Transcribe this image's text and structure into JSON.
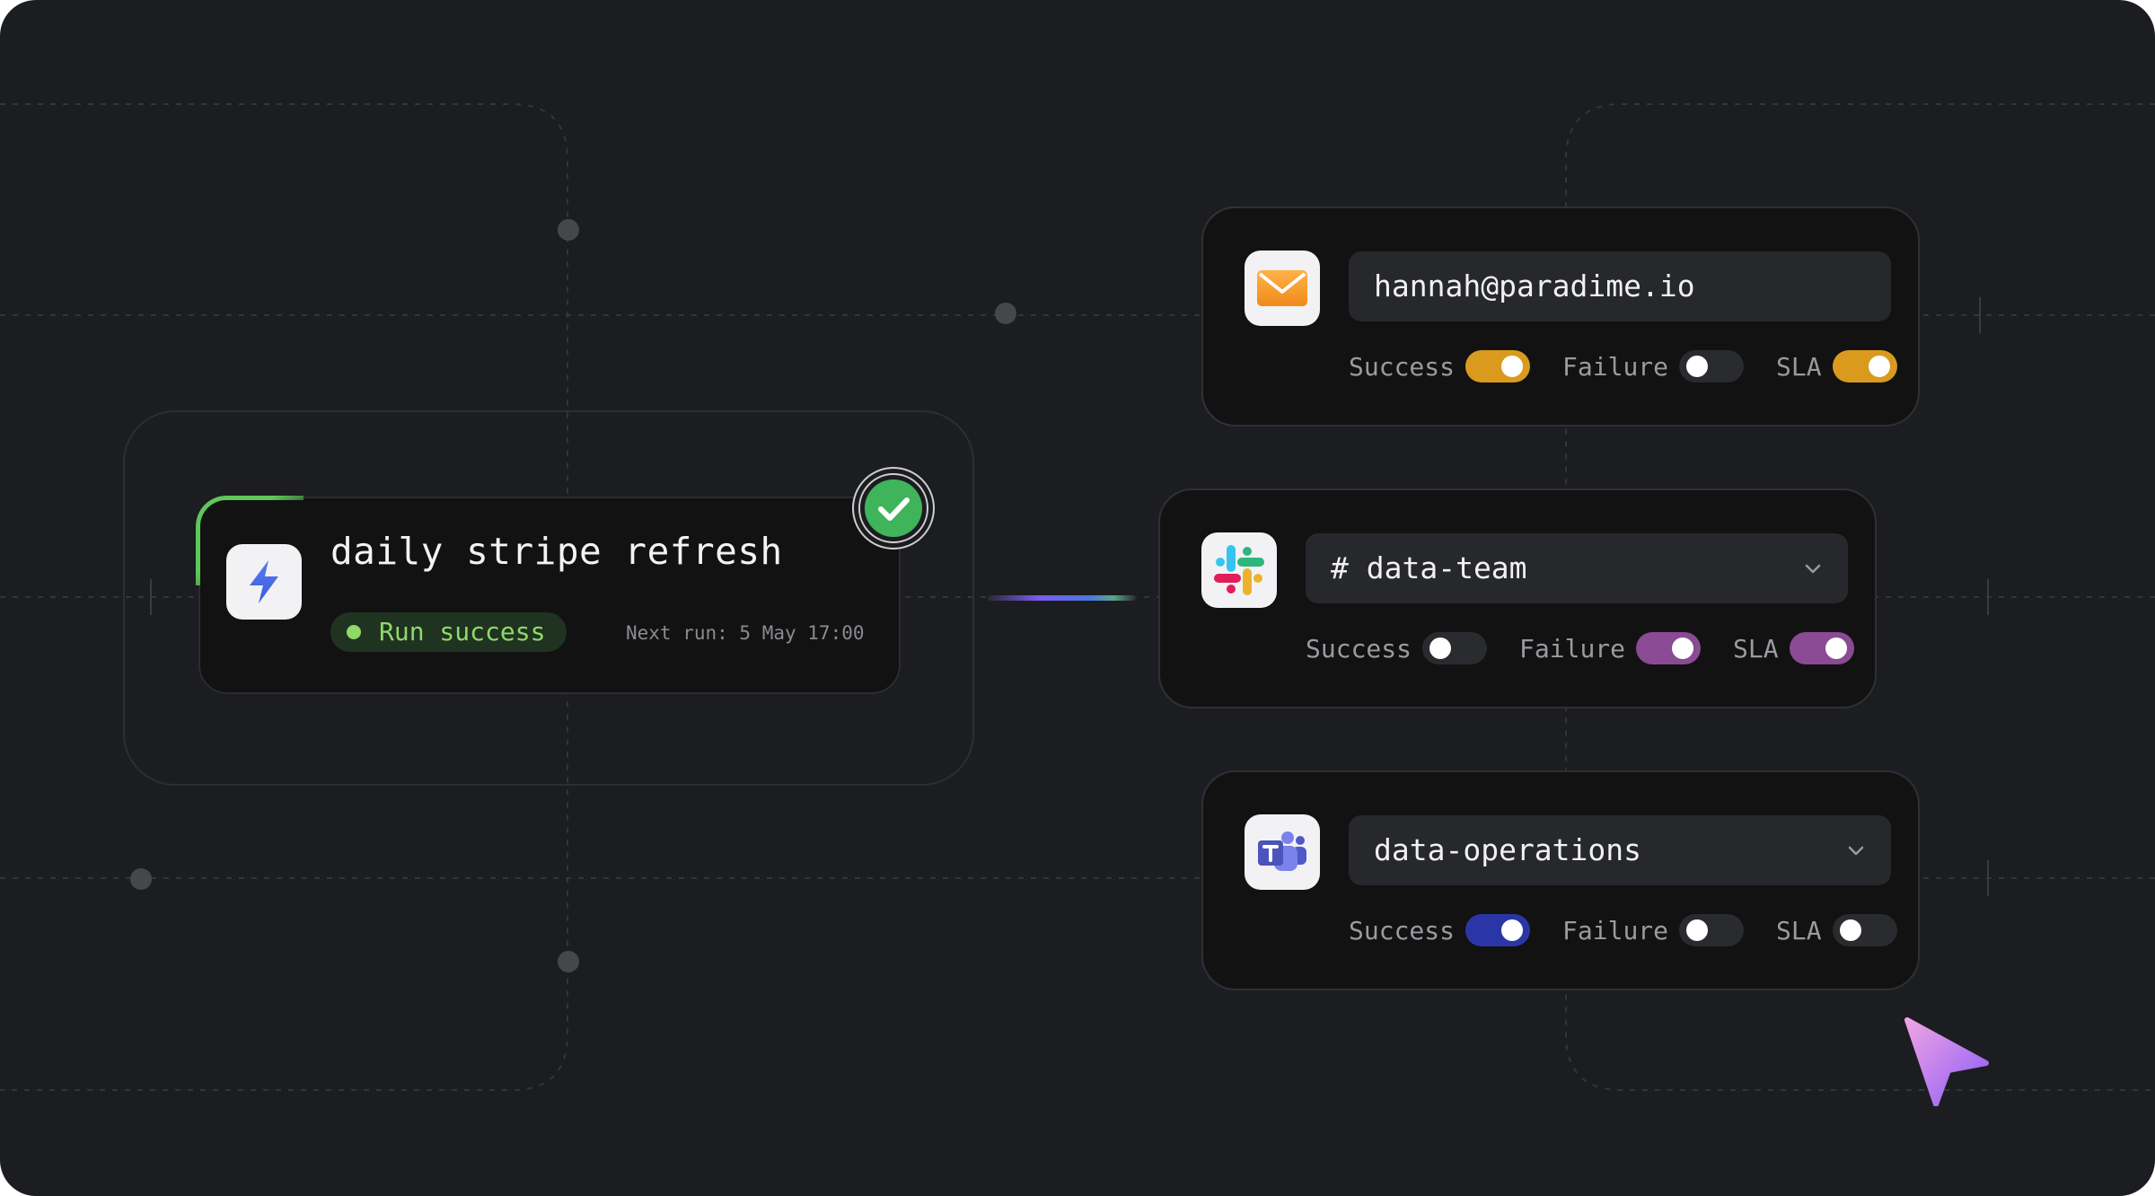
{
  "colors": {
    "background": "#1c1d20",
    "card": "#121213",
    "success_green": "#5fc75a",
    "email_accent": "#c08a30",
    "slack_accent": "#5b2660",
    "teams_accent": "#3b3f9a",
    "toggle_gold": "#d99a1e",
    "toggle_purple": "#8a4a94",
    "toggle_navy": "#2b36a6",
    "toggle_off": "#2a2b2f"
  },
  "job": {
    "icon": "lightning-bolt-icon",
    "title": "daily stripe refresh",
    "status": "Run success",
    "next_run": "Next run: 5 May 17:00",
    "check_icon": "checkmark-icon"
  },
  "notifications": [
    {
      "channel": "email",
      "icon": "email-envelope-icon",
      "value": "hannah@paradime.io",
      "has_dropdown": false,
      "toggles": [
        {
          "label": "Success",
          "on": true
        },
        {
          "label": "Failure",
          "on": false
        },
        {
          "label": "SLA",
          "on": true
        }
      ]
    },
    {
      "channel": "slack",
      "icon": "slack-logo-icon",
      "value": "# data-team",
      "has_dropdown": true,
      "toggles": [
        {
          "label": "Success",
          "on": false
        },
        {
          "label": "Failure",
          "on": true
        },
        {
          "label": "SLA",
          "on": true
        }
      ]
    },
    {
      "channel": "teams",
      "icon": "microsoft-teams-icon",
      "value": "data-operations",
      "has_dropdown": true,
      "toggles": [
        {
          "label": "Success",
          "on": true
        },
        {
          "label": "Failure",
          "on": false
        },
        {
          "label": "SLA",
          "on": false
        }
      ]
    }
  ]
}
